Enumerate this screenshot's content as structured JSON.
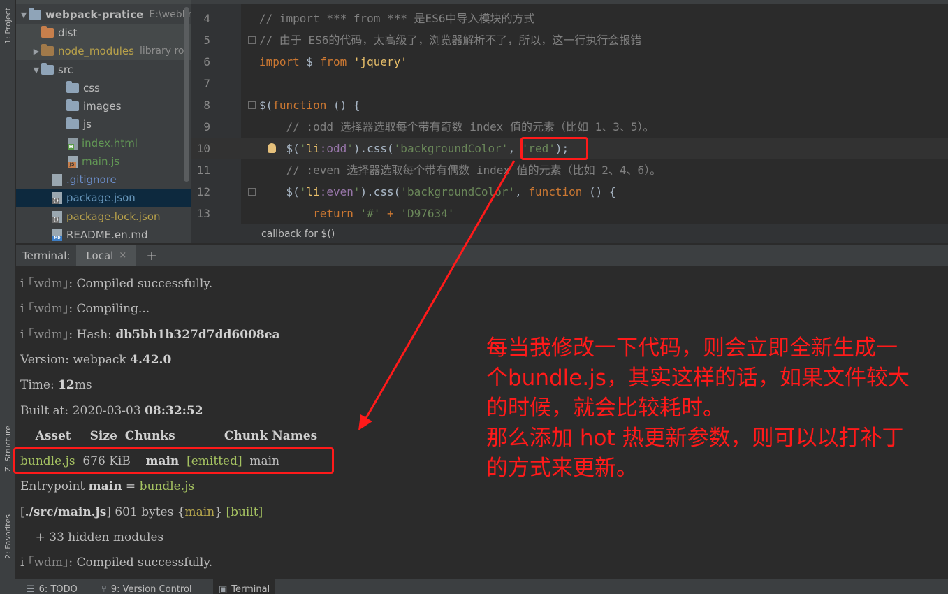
{
  "left_strip": {
    "project_tab": "1: Project",
    "structure_tab": "Z: Structure",
    "favorites_tab": "2: Favorites"
  },
  "project_tree": {
    "root": {
      "name": "webpack-pratice",
      "path": "E:\\webPro"
    },
    "items": [
      {
        "label": "dist"
      },
      {
        "label": "node_modules",
        "suffix": "library ro"
      },
      {
        "label": "src"
      },
      {
        "label": "css"
      },
      {
        "label": "images"
      },
      {
        "label": "js"
      },
      {
        "label": "index.html"
      },
      {
        "label": "main.js"
      },
      {
        "label": ".gitignore"
      },
      {
        "label": "package.json"
      },
      {
        "label": "package-lock.json"
      },
      {
        "label": "README.en.md"
      }
    ]
  },
  "editor": {
    "lines": [
      {
        "num": "4",
        "tokens": [
          {
            "t": "// import *** from *** 是ES6中导入模块的方式",
            "c": "comment"
          }
        ]
      },
      {
        "num": "5",
        "tokens": [
          {
            "t": "// 由于 ES6的代码，太高级了，浏览器解析不了，所以，这一行执行会报错",
            "c": "comment"
          }
        ]
      },
      {
        "num": "6",
        "tokens": [
          {
            "t": "import",
            "c": "kw"
          },
          {
            "t": " $ ",
            "c": "plain"
          },
          {
            "t": "from",
            "c": "kw"
          },
          {
            "t": " ",
            "c": "plain"
          },
          {
            "t": "'jquery'",
            "c": "str-red"
          }
        ]
      },
      {
        "num": "7",
        "tokens": []
      },
      {
        "num": "8",
        "tokens": [
          {
            "t": "$(",
            "c": "plain"
          },
          {
            "t": "function",
            "c": "kw"
          },
          {
            "t": " () {",
            "c": "plain"
          }
        ]
      },
      {
        "num": "9",
        "tokens": [
          {
            "t": "    // :odd 选择器选取每个带有奇数 index 值的元素（比如 1、3、5）。",
            "c": "comment"
          }
        ]
      },
      {
        "num": "10",
        "tokens": [
          {
            "t": "    $(",
            "c": "plain"
          },
          {
            "t": "'",
            "c": "str"
          },
          {
            "t": "li",
            "c": "str-red"
          },
          {
            "t": ":odd",
            "c": "purple"
          },
          {
            "t": "'",
            "c": "str"
          },
          {
            "t": ").css(",
            "c": "plain"
          },
          {
            "t": "'backgroundColor'",
            "c": "str"
          },
          {
            "t": ", ",
            "c": "plain"
          },
          {
            "t": "'red'",
            "c": "str"
          },
          {
            "t": ");",
            "c": "plain"
          }
        ]
      },
      {
        "num": "11",
        "tokens": [
          {
            "t": "    // :even 选择器选取每个带有偶数 index 值的元素（比如 2、4、6）。",
            "c": "comment"
          }
        ]
      },
      {
        "num": "12",
        "tokens": [
          {
            "t": "    $(",
            "c": "plain"
          },
          {
            "t": "'",
            "c": "str"
          },
          {
            "t": "li",
            "c": "str-red"
          },
          {
            "t": ":even",
            "c": "purple"
          },
          {
            "t": "'",
            "c": "str"
          },
          {
            "t": ").css(",
            "c": "plain"
          },
          {
            "t": "'backgroundColor'",
            "c": "str"
          },
          {
            "t": ", ",
            "c": "plain"
          },
          {
            "t": "function",
            "c": "kw"
          },
          {
            "t": " () {",
            "c": "plain"
          }
        ]
      },
      {
        "num": "13",
        "tokens": [
          {
            "t": "        ",
            "c": "plain"
          },
          {
            "t": "return",
            "c": "kw"
          },
          {
            "t": " ",
            "c": "plain"
          },
          {
            "t": "'#'",
            "c": "str"
          },
          {
            "t": " + ",
            "c": "kw"
          },
          {
            "t": "'D97634'",
            "c": "str"
          }
        ]
      }
    ],
    "breadcrumb": "callback for $()"
  },
  "terminal": {
    "header_title": "Terminal:",
    "tab_label": "Local",
    "tab_close": "×",
    "new_tab": "+",
    "lines": [
      [
        {
          "t": "i ",
          "c": ""
        },
        {
          "t": "｢wdm｣",
          "c": "dim"
        },
        {
          "t": ": Compiled successfully.",
          "c": ""
        }
      ],
      [
        {
          "t": "i ",
          "c": ""
        },
        {
          "t": "｢wdm｣",
          "c": "dim"
        },
        {
          "t": ": Compiling...",
          "c": ""
        }
      ],
      [
        {
          "t": "i ",
          "c": ""
        },
        {
          "t": "｢wdm｣",
          "c": "dim"
        },
        {
          "t": ": Hash: ",
          "c": ""
        },
        {
          "t": "db5bb1b327d7dd6008ea",
          "c": "bold"
        }
      ],
      [
        {
          "t": "Version: webpack ",
          "c": ""
        },
        {
          "t": "4.42.0",
          "c": "bold"
        }
      ],
      [
        {
          "t": "Time: ",
          "c": ""
        },
        {
          "t": "12",
          "c": "bold"
        },
        {
          "t": "ms",
          "c": ""
        }
      ],
      [
        {
          "t": "Built at: 2020-03-03 ",
          "c": ""
        },
        {
          "t": "08:32:52",
          "c": "bold"
        }
      ],
      [
        {
          "t": "    ",
          "c": ""
        },
        {
          "t": "Asset",
          "c": "bold"
        },
        {
          "t": "     ",
          "c": ""
        },
        {
          "t": "Size",
          "c": "bold"
        },
        {
          "t": "  ",
          "c": ""
        },
        {
          "t": "Chunks",
          "c": "bold"
        },
        {
          "t": "             ",
          "c": ""
        },
        {
          "t": "Chunk Names",
          "c": "bold"
        }
      ],
      [
        {
          "t": "bundle.js",
          "c": "green"
        },
        {
          "t": "  676 KiB    ",
          "c": ""
        },
        {
          "t": "main",
          "c": "bold"
        },
        {
          "t": "  ",
          "c": ""
        },
        {
          "t": "[emitted]",
          "c": "green"
        },
        {
          "t": "  main",
          "c": ""
        }
      ],
      [
        {
          "t": "Entrypoint ",
          "c": ""
        },
        {
          "t": "main",
          "c": "bold"
        },
        {
          "t": " = ",
          "c": ""
        },
        {
          "t": "bundle.js",
          "c": "green"
        }
      ],
      [
        {
          "t": "[",
          "c": ""
        },
        {
          "t": "./src/main.js",
          "c": "bold"
        },
        {
          "t": "] 601 bytes {",
          "c": ""
        },
        {
          "t": "main",
          "c": "olive"
        },
        {
          "t": "} ",
          "c": ""
        },
        {
          "t": "[built]",
          "c": "green"
        }
      ],
      [
        {
          "t": "    + 33 hidden modules",
          "c": ""
        }
      ],
      [
        {
          "t": "i ",
          "c": ""
        },
        {
          "t": "｢wdm｣",
          "c": "dim"
        },
        {
          "t": ": Compiled successfully.",
          "c": ""
        }
      ]
    ]
  },
  "bottom_bar": {
    "todo": "6: TODO",
    "vcs": "9: Version Control",
    "terminal": "Terminal"
  },
  "annotation": {
    "text_lines": [
      "每当我修改一下代码，则会立即全新生成一",
      "个bundle.js，其实这样的话，如果文件较大",
      "的时候，就会比较耗时。",
      "那么添加 hot 热更新参数，则可以以打补丁",
      "的方式来更新。"
    ],
    "color": "#ff1a1a"
  }
}
